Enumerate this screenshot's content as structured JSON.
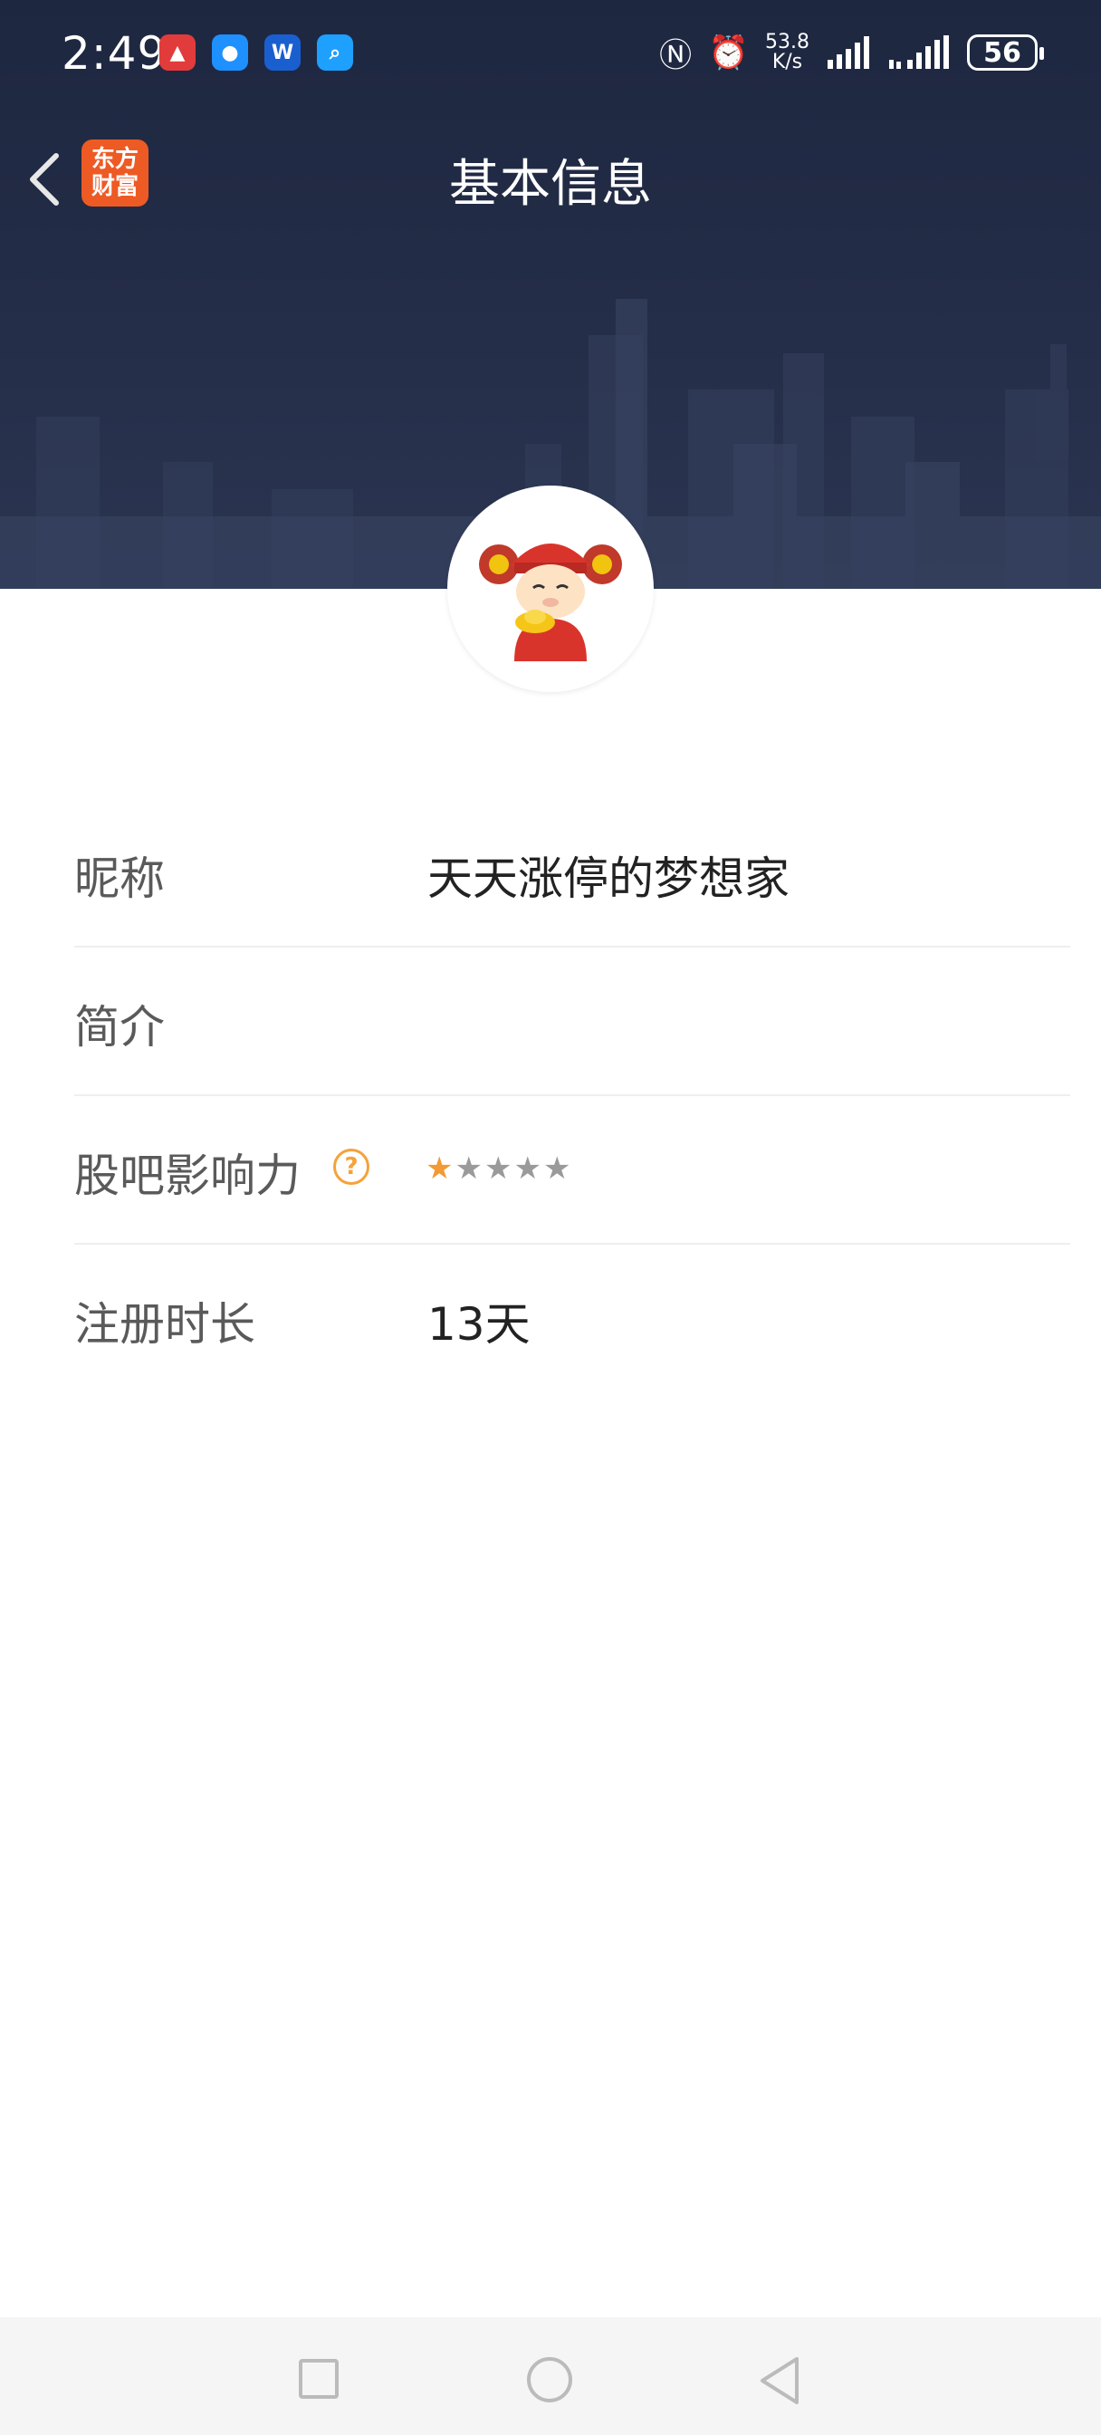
{
  "status_bar": {
    "time": "2:49",
    "net_speed_value": "53.8",
    "net_speed_unit": "K/s",
    "battery": "56"
  },
  "nav": {
    "title": "基本信息",
    "app_logo_text_line1": "东方",
    "app_logo_text_line2": "财富"
  },
  "info": {
    "nickname_label": "昵称",
    "nickname_value": "天天涨停的梦想家",
    "intro_label": "简介",
    "intro_value": "",
    "influence_label": "股吧影响力",
    "influence_help": "?",
    "influence_rating": 1,
    "influence_max": 5,
    "register_label": "注册时长",
    "register_value": "13天"
  },
  "colors": {
    "header_bg": "#232c46",
    "star_on": "#f29a33",
    "star_off": "#9a9a9a",
    "help_icon": "#f5a23a"
  }
}
